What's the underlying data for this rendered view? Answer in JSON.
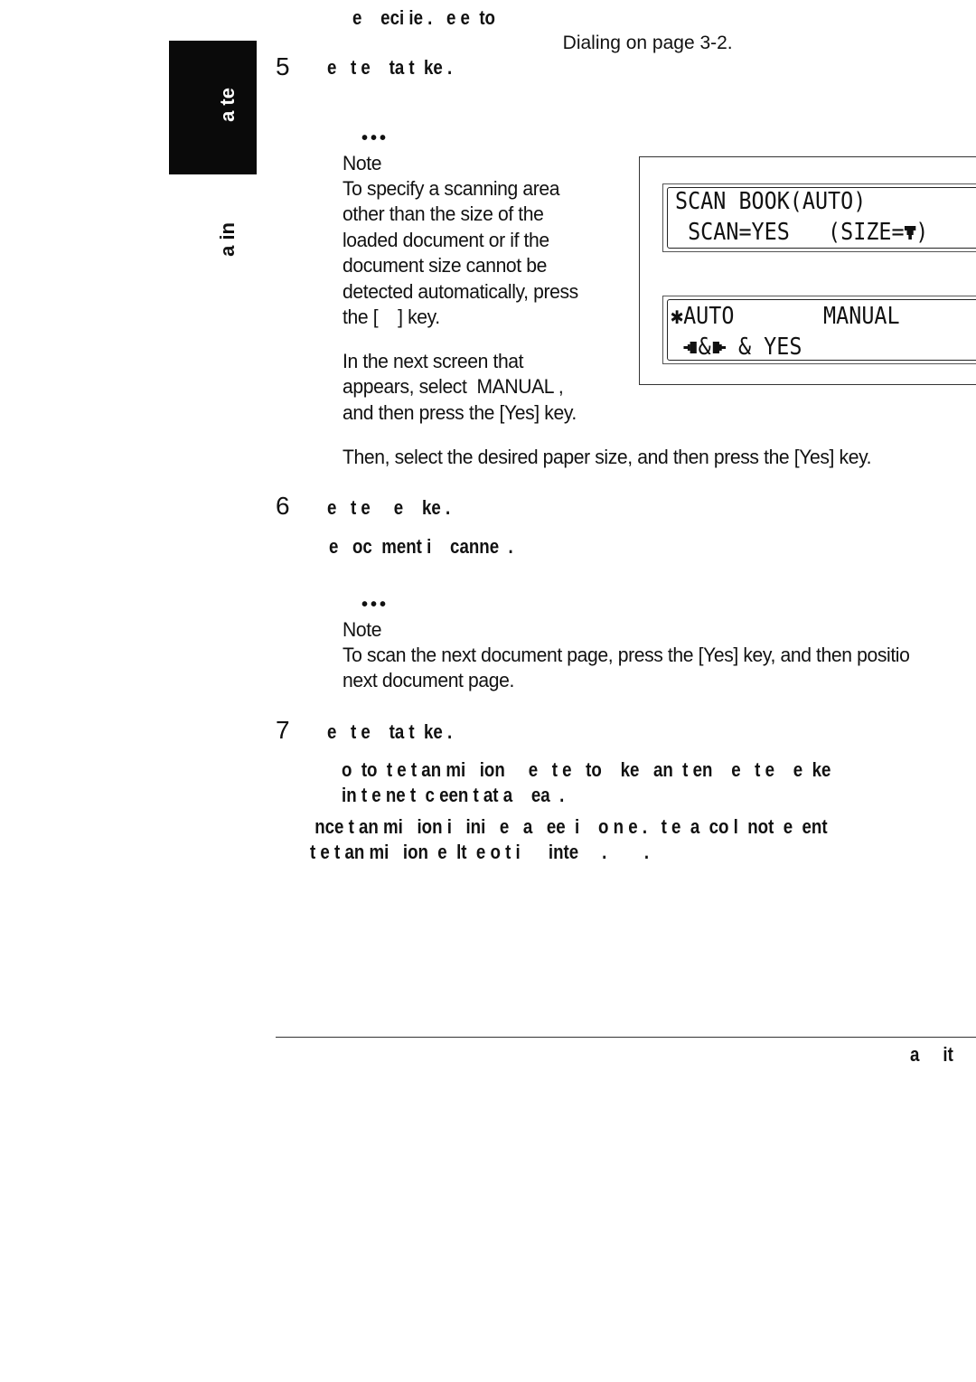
{
  "top_line": {
    "bold_fragment": "e    eci ie .   e e  to",
    "link_text": "Dialing",
    "tail": " on page 3-2."
  },
  "side_tab": {
    "tab_label": "a te",
    "section_label": "a in"
  },
  "steps": [
    {
      "number": "5",
      "heading": "e   t e    ta t  ke .",
      "note": {
        "dots": "•••",
        "title": "Note",
        "lines": [
          "To specify a scanning area",
          "other than the size of the",
          "loaded document or if the",
          "document size cannot be",
          "detected automatically, press",
          "the [    ] key."
        ],
        "lines2": [
          "In the next screen that",
          "appears, select  MANUAL ,",
          "and then press the [Yes] key."
        ],
        "followup": "Then, select the desired paper size, and then press the [Yes] key."
      },
      "lcd": {
        "screen1": {
          "line1": "SCAN BOOK(AUTO)",
          "line2": " SCAN=YES   (SIZE=",
          "line2_icon": "down-arrow-icon",
          "line2_end": ")"
        },
        "screen2": {
          "line1_marker": "✱",
          "line1": "AUTO       MANUAL",
          "line2_left_icon": "left-arrow-icon",
          "line2_amp": "&",
          "line2_right_icon": "right-arrow-icon",
          "line2_rest": " & YES"
        }
      }
    },
    {
      "number": "6",
      "heading": "e   t e     e    ke .",
      "subline": "e   oc  ment i    canne  .",
      "note": {
        "dots": "•••",
        "title": "Note",
        "lines": [
          "To scan the next document page, press the [Yes] key, and then positio",
          "next document page."
        ]
      }
    },
    {
      "number": "7",
      "heading": "e   t e    ta t  ke .",
      "body_lines": [
        "o  to  t e t an mi   ion     e   t e   to    ke   an  t en    e   t e    e  ke",
        "in t e ne t  c een t at a    ea  ."
      ],
      "warning_lines": [
        " nce t an mi   ion i   ini   e   a   ee  i    o n e .   t e  a  co l  not  e  ent",
        "t e t an mi   ion  e  lt  e o t i      inte     .        ."
      ]
    }
  ],
  "footer": {
    "text": "a     it"
  }
}
